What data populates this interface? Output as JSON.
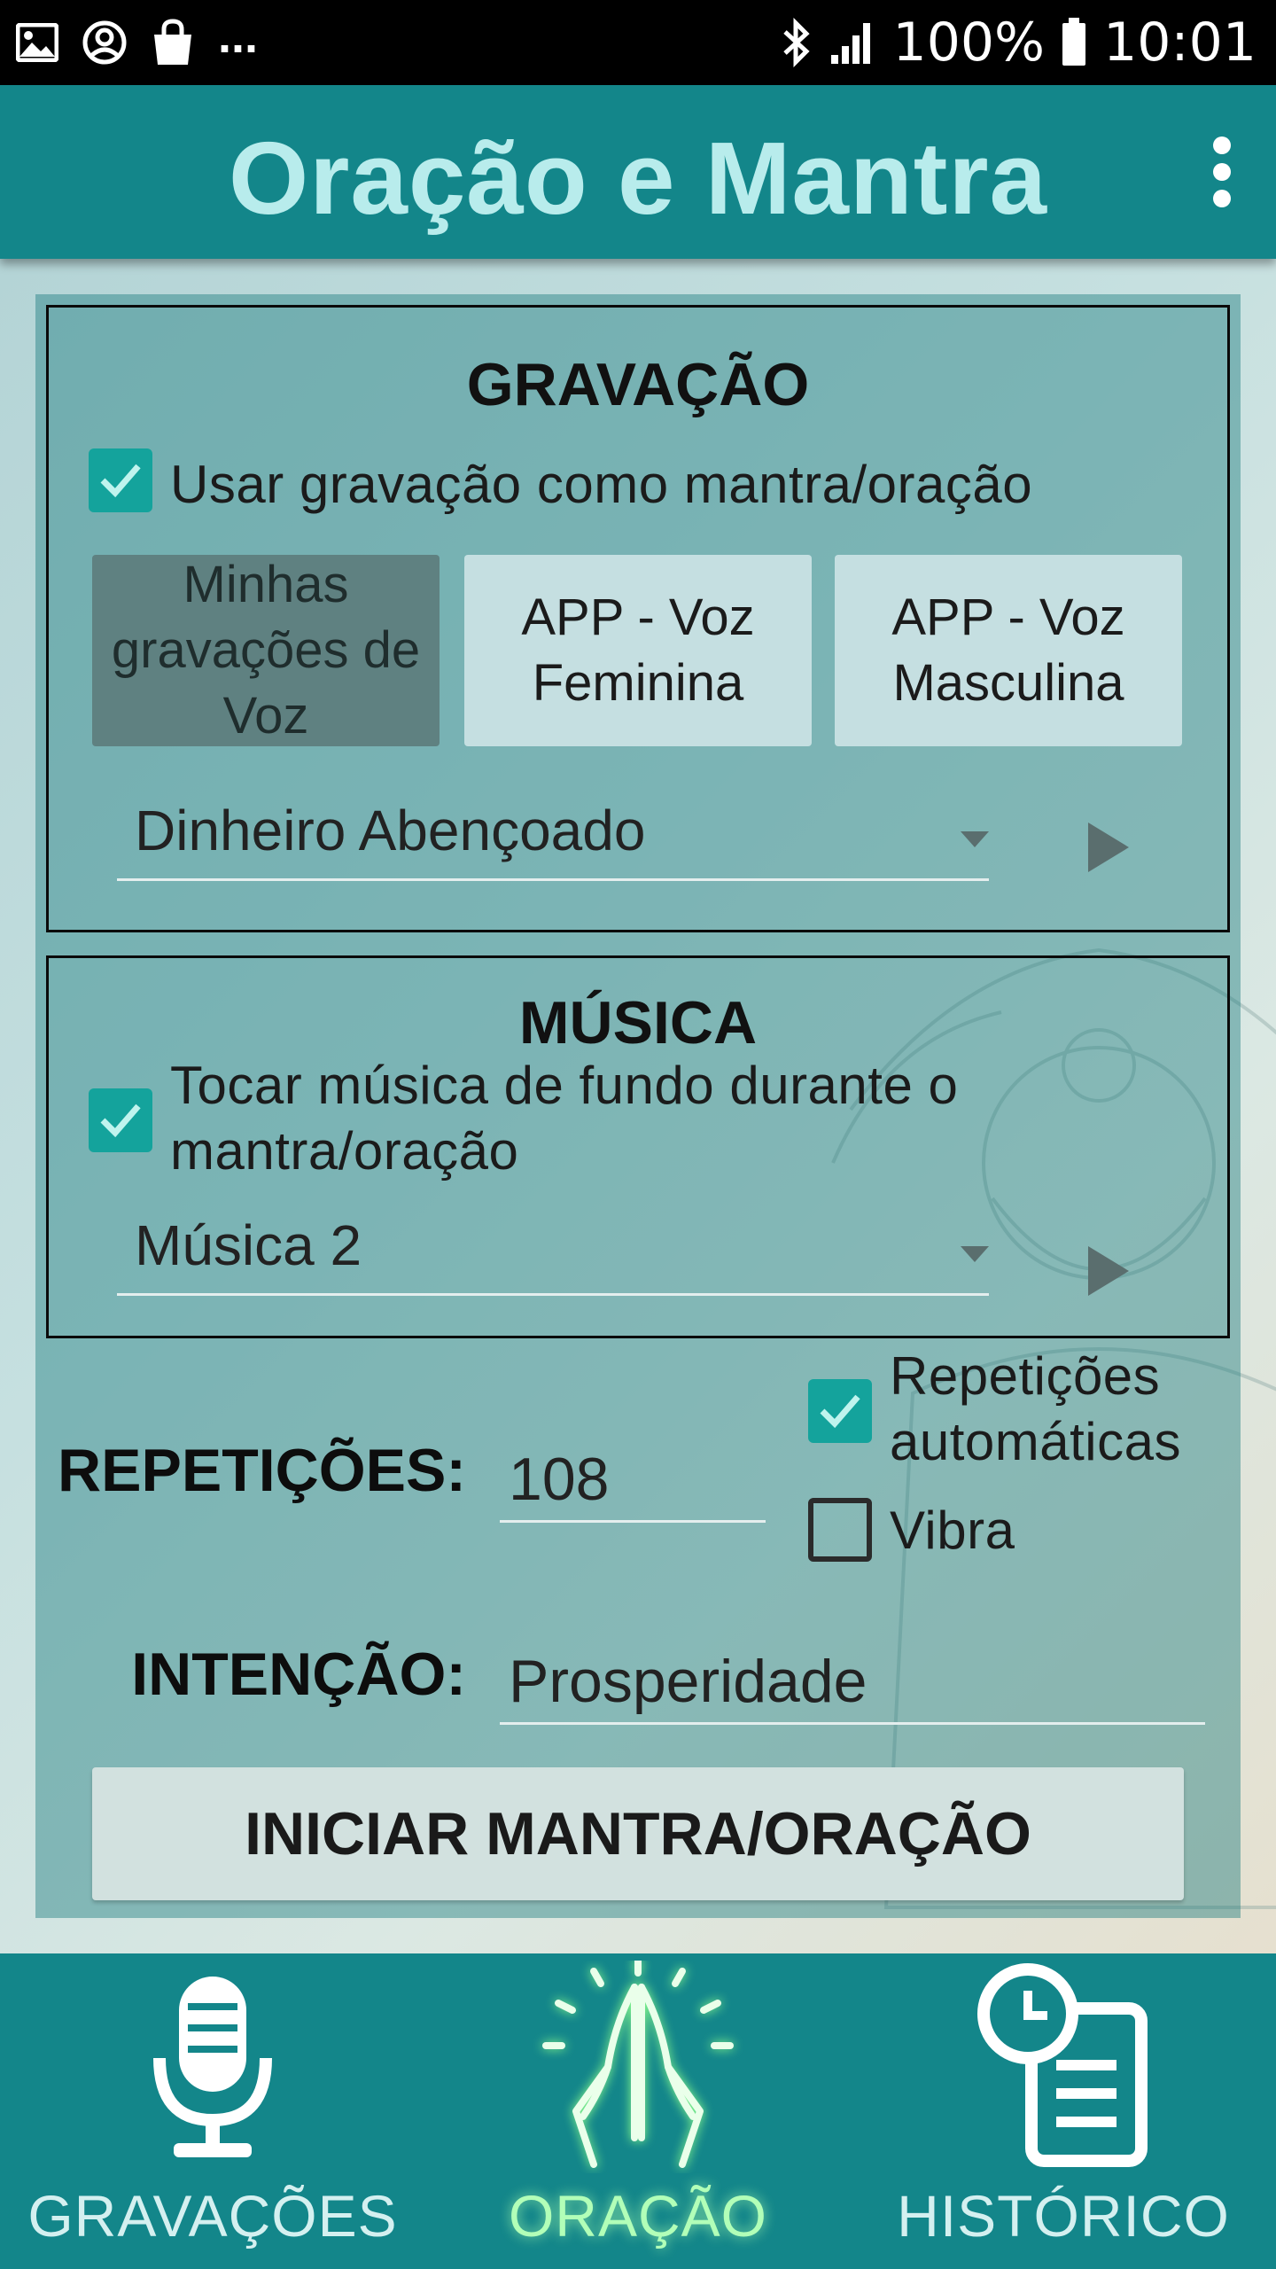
{
  "status_bar": {
    "icons_left": [
      "image-icon",
      "account-circle-icon",
      "shopping-bag-icon"
    ],
    "ellipsis": "...",
    "battery": "100%",
    "time": "10:01"
  },
  "app_bar": {
    "title": "Oração e Mantra",
    "menu_icon": "more-vert-icon"
  },
  "gravacao": {
    "title": "GRAVAÇÃO",
    "checkbox_label": "Usar gravação como mantra/oração",
    "checkbox_checked": true,
    "buttons": [
      {
        "label": "Minhas gravações de Voz",
        "selected": true
      },
      {
        "label": "APP - Voz Feminina",
        "selected": false
      },
      {
        "label": "APP - Voz Masculina",
        "selected": false
      }
    ],
    "selected_recording": "Dinheiro Abençoado"
  },
  "musica": {
    "title": "MÚSICA",
    "checkbox_label": "Tocar música de fundo durante o mantra/oração",
    "checkbox_checked": true,
    "selected_music": "Música 2"
  },
  "repeticoes": {
    "label": "REPETIÇÕES:",
    "value": "108",
    "auto_label": "Repetições automáticas",
    "auto_checked": true,
    "vibra_label": "Vibra",
    "vibra_checked": false
  },
  "intencao": {
    "label": "INTENÇÃO:",
    "value": "Prosperidade"
  },
  "start_button": "INICIAR MANTRA/ORAÇÃO",
  "bottom_nav": [
    {
      "label": "GRAVAÇÕES",
      "icon": "microphone-icon",
      "active": false
    },
    {
      "label": "ORAÇÃO",
      "icon": "praying-hands-icon",
      "active": true
    },
    {
      "label": "HISTÓRICO",
      "icon": "history-document-icon",
      "active": false
    }
  ],
  "colors": {
    "primary": "#13868a",
    "title_text": "#b8ecec",
    "checkbox": "#14a39c",
    "active_nav": "#b2ffb8"
  }
}
